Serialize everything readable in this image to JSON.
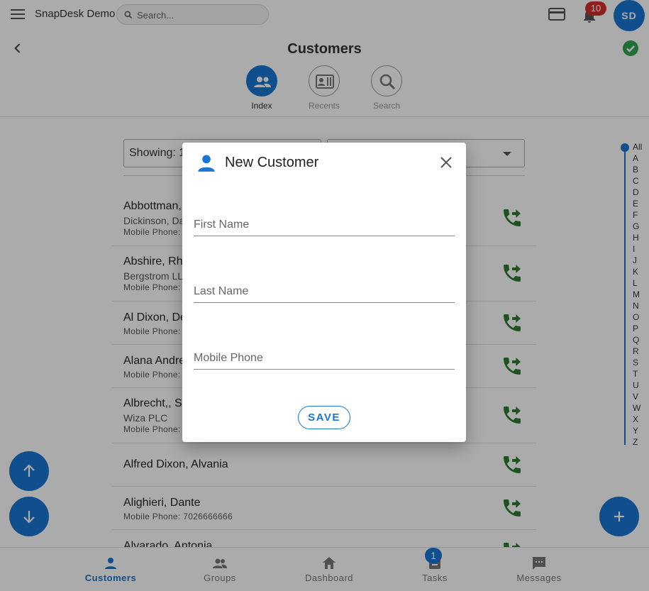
{
  "topbar": {
    "app_title": "SnapDesk Demo",
    "search_placeholder": "Search...",
    "notification_count": "10",
    "avatar_initials": "SD"
  },
  "page": {
    "title": "Customers",
    "subnav": [
      {
        "label": "Index",
        "icon": "people-icon",
        "active": true
      },
      {
        "label": "Recents",
        "icon": "contact-card-icon",
        "active": false
      },
      {
        "label": "Search",
        "icon": "search-icon",
        "active": false
      }
    ]
  },
  "filters": {
    "showing_text": "Showing: 1",
    "sort_value": ""
  },
  "customers": [
    {
      "name": "Abbottman,",
      "company": "Dickinson, Da",
      "phone": "Mobile Phone:"
    },
    {
      "name": "Abshire, Rhe",
      "company": "Bergstrom LL",
      "phone": "Mobile Phone:"
    },
    {
      "name": "Al Dixon, De",
      "company": "",
      "phone": "Mobile Phone:"
    },
    {
      "name": "Alana Andre",
      "company": "",
      "phone": "Mobile Phone:"
    },
    {
      "name": "Albrecht,, Sh",
      "company": "Wiza PLC",
      "phone": "Mobile Phone:"
    },
    {
      "name": "Alfred Dixon, Alvania",
      "company": "",
      "phone": ""
    },
    {
      "name": "Alighieri, Dante",
      "company": "",
      "phone": "Mobile Phone: 7026666666"
    },
    {
      "name": "Alvarado, Antonia",
      "company": "",
      "phone": ""
    }
  ],
  "alphabet": [
    "All",
    "A",
    "B",
    "C",
    "D",
    "E",
    "F",
    "G",
    "H",
    "I",
    "J",
    "K",
    "L",
    "M",
    "N",
    "O",
    "P",
    "Q",
    "R",
    "S",
    "T",
    "U",
    "V",
    "W",
    "X",
    "Y",
    "Z"
  ],
  "bottom_nav": [
    {
      "label": "Customers",
      "icon": "person-icon",
      "active": true
    },
    {
      "label": "Groups",
      "icon": "groups-icon",
      "active": false
    },
    {
      "label": "Dashboard",
      "icon": "home-icon",
      "active": false
    },
    {
      "label": "Tasks",
      "icon": "tasks-icon",
      "active": false,
      "badge": "1"
    },
    {
      "label": "Messages",
      "icon": "message-icon",
      "active": false
    }
  ],
  "dialog": {
    "title": "New Customer",
    "fields": [
      {
        "placeholder": "First Name"
      },
      {
        "placeholder": "Last Name"
      },
      {
        "placeholder": "Mobile Phone"
      }
    ],
    "save_label": "SAVE"
  },
  "colors": {
    "primary": "#1976d2",
    "call_green": "#2e7d32",
    "badge_red": "#d32f2f",
    "success": "#2ea44f"
  }
}
